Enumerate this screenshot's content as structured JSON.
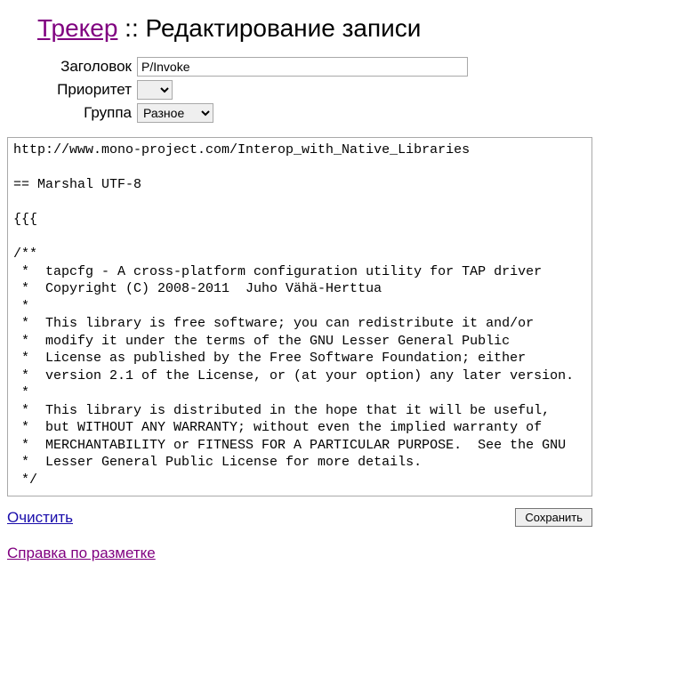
{
  "header": {
    "link_text": "Трекер",
    "separator": " :: ",
    "title": "Редактирование записи"
  },
  "form": {
    "title_label": "Заголовок",
    "title_value": "P/Invoke",
    "priority_label": "Приоритет",
    "priority_value": "",
    "group_label": "Группа",
    "group_value": "Разное"
  },
  "body_text": "http://www.mono-project.com/Interop_with_Native_Libraries\n\n== Marshal UTF-8\n\n{{{\n\n/**\n *  tapcfg - A cross-platform configuration utility for TAP driver\n *  Copyright (C) 2008-2011  Juho Vähä-Herttua\n *\n *  This library is free software; you can redistribute it and/or\n *  modify it under the terms of the GNU Lesser General Public\n *  License as published by the Free Software Foundation; either\n *  version 2.1 of the License, or (at your option) any later version.\n *\n *  This library is distributed in the hope that it will be useful,\n *  but WITHOUT ANY WARRANTY; without even the implied warranty of\n *  MERCHANTABILITY or FITNESS FOR A PARTICULAR PURPOSE.  See the GNU\n *  Lesser General Public License for more details.\n */",
  "actions": {
    "clear_label": "Очистить",
    "save_label": "Сохранить"
  },
  "markup_help_label": "Справка по разметке"
}
